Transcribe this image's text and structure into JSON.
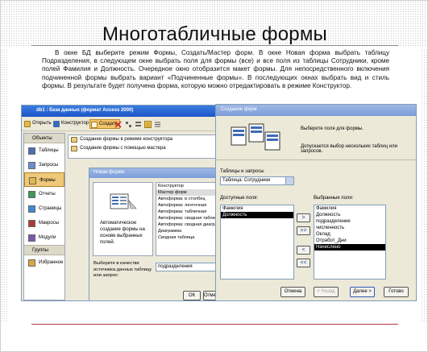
{
  "slide": {
    "title": "Многотабличные формы",
    "body": "В окне БД выберите режим Формы, Создать/Мастер форм. В окне Новая форма выбрать таблицу Подразделения, в следующем окне выбрать поля для формы (все) и все поля из таблицы Сотрудники, кроме полей Фамилия и Должность. Очередное окно отобразится макет формы. Для непосредственного включения подчиненной формы выбрать вариант «Подчиненные формы». В последующих окнах выбрать вид и стиль формы. В результате будет получена форма, которую можно отредактировать в режиме Конструктор."
  },
  "access_window": {
    "title": "db1 : база данных (формат Access 2000)",
    "toolbar": {
      "open": "Открыть",
      "design": "Конструктор",
      "create": "Создать"
    },
    "objects_header": "Объекты",
    "objects": [
      {
        "label": "Таблицы",
        "icon": "table-icon",
        "color": "#4b6fb5"
      },
      {
        "label": "Запросы",
        "icon": "query-icon",
        "color": "#6a8fd0"
      },
      {
        "label": "Формы",
        "icon": "form-icon",
        "color": "#e6b84a",
        "selected": true
      },
      {
        "label": "Отчеты",
        "icon": "report-icon",
        "color": "#3f9b55"
      },
      {
        "label": "Страницы",
        "icon": "page-icon",
        "color": "#3a8ad6"
      },
      {
        "label": "Макросы",
        "icon": "macro-icon",
        "color": "#b13a3a"
      },
      {
        "label": "Модули",
        "icon": "module-icon",
        "color": "#7a56b5"
      }
    ],
    "groups_header": "Группы",
    "favorites": "Избранное",
    "form_list": [
      "Создание формы в режиме конструктора",
      "Создание формы с помощью мастера"
    ]
  },
  "new_form_dialog": {
    "title": "Новая форма",
    "description": "Автоматическое создание формы на основе выбранных полей.",
    "options": [
      "Конструктор",
      "Мастер форм",
      "Автоформа: в столбец",
      "Автоформа: ленточная",
      "Автоформа: табличная",
      "Автоформа: сводная таблица",
      "Автоформа: сводная диаграмма",
      "Диаграмма",
      "Сводная таблица"
    ],
    "selected_option": "Мастер форм",
    "choose_label": "Выберите в качестве источника данных таблицу или запрос:",
    "table_value": "подразделения",
    "ok": "ОК",
    "cancel": "Отмена"
  },
  "wizard": {
    "title": "Создание форм",
    "choose_fields": "Выберите поля для формы.",
    "multi_tables": "Допускается выбор нескольких таблиц или запросов.",
    "tables_label": "Таблицы и запросы",
    "tables_value": "Таблица: Сотрудники",
    "available_label": "Доступные поля:",
    "available": [
      "Фамилия",
      "Должность"
    ],
    "selected_label": "Выбранные поля:",
    "selected": [
      "Фамилия",
      "Должность",
      "подразделение",
      "численность",
      "Оклад",
      "Отработ_Дни",
      "Начислено"
    ],
    "selected_highlight": "Начислено",
    "move_buttons": [
      ">",
      ">>",
      "<",
      "<<"
    ],
    "buttons": {
      "cancel": "Отмена",
      "back": "< Назад",
      "next": "Далее >",
      "finish": "Готово"
    }
  }
}
